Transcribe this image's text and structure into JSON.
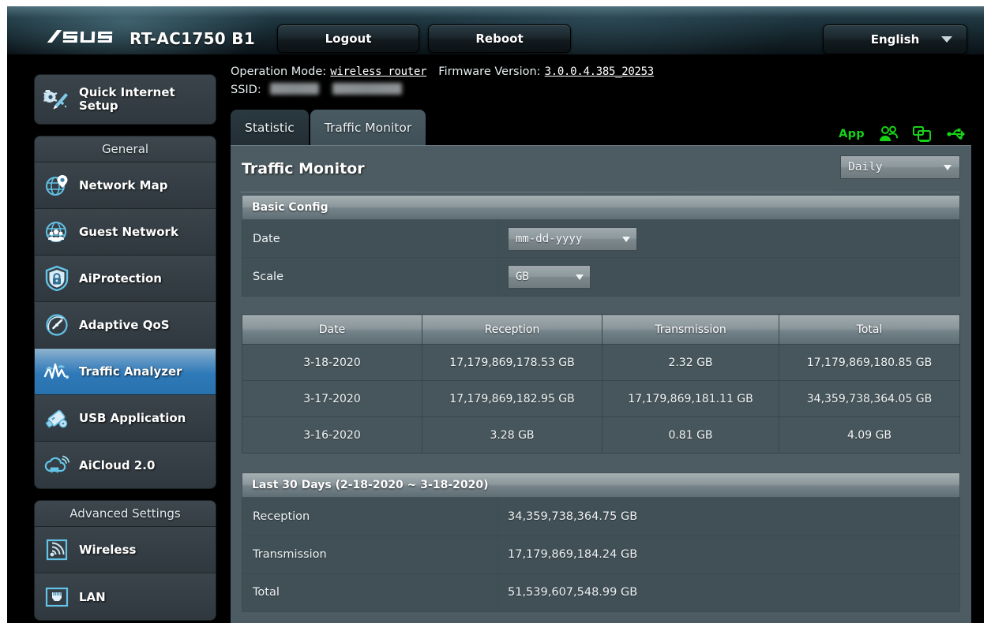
{
  "header": {
    "brand": "/ISUS",
    "model": "RT-AC1750 B1",
    "logout_label": "Logout",
    "reboot_label": "Reboot",
    "language": "English",
    "language_caret": "chevron-down-icon"
  },
  "info": {
    "operation_mode_label": "Operation Mode:",
    "operation_mode_value": "wireless router",
    "firmware_label": "Firmware Version:",
    "firmware_value": "3.0.0.4.385_20253",
    "ssid_label": "SSID:",
    "ssid_value_1": "",
    "ssid_value_2": ""
  },
  "top_icons": {
    "app_label": "App",
    "icons": [
      "clients-icon",
      "screen-share-icon",
      "usb-icon"
    ],
    "color": "#17d217"
  },
  "sidebar": {
    "quick": {
      "label_line1": "Quick Internet",
      "label_line2": "Setup",
      "icon": "quick-setup-icon"
    },
    "groups": [
      {
        "title": "General",
        "items": [
          {
            "label": "Network Map",
            "icon": "network-map-icon",
            "active": false
          },
          {
            "label": "Guest Network",
            "icon": "guest-network-icon",
            "active": false
          },
          {
            "label": "AiProtection",
            "icon": "shield-lock-icon",
            "active": false
          },
          {
            "label": "Adaptive QoS",
            "icon": "gauge-icon",
            "active": false
          },
          {
            "label": "Traffic Analyzer",
            "icon": "traffic-analyzer-icon",
            "active": true
          },
          {
            "label": "USB Application",
            "icon": "usb-drive-icon",
            "active": false
          },
          {
            "label": "AiCloud 2.0",
            "icon": "cloud-icon",
            "active": false
          }
        ]
      },
      {
        "title": "Advanced Settings",
        "items": [
          {
            "label": "Wireless",
            "icon": "wireless-icon",
            "active": false
          },
          {
            "label": "LAN",
            "icon": "lan-port-icon",
            "active": false
          }
        ]
      }
    ]
  },
  "tabs": [
    {
      "label": "Statistic",
      "active": false
    },
    {
      "label": "Traffic Monitor",
      "active": true
    }
  ],
  "panel": {
    "title": "Traffic Monitor",
    "period_selected": "Daily",
    "basic_config": {
      "section_title": "Basic Config",
      "rows": [
        {
          "label": "Date",
          "value": "mm-dd-yyyy"
        },
        {
          "label": "Scale",
          "value": "GB"
        }
      ]
    },
    "table": {
      "columns": [
        "Date",
        "Reception",
        "Transmission",
        "Total"
      ],
      "rows": [
        [
          "3-18-2020",
          "17,179,869,178.53 GB",
          "2.32 GB",
          "17,179,869,180.85 GB"
        ],
        [
          "3-17-2020",
          "17,179,869,182.95 GB",
          "17,179,869,181.11 GB",
          "34,359,738,364.05 GB"
        ],
        [
          "3-16-2020",
          "3.28 GB",
          "0.81 GB",
          "4.09 GB"
        ]
      ]
    },
    "summary": {
      "section_title": "Last 30 Days (2-18-2020 ~ 3-18-2020)",
      "rows": [
        {
          "label": "Reception",
          "value": "34,359,738,364.75 GB"
        },
        {
          "label": "Transmission",
          "value": "17,179,869,184.24 GB"
        },
        {
          "label": "Total",
          "value": "51,539,607,548.99 GB"
        }
      ]
    }
  },
  "colors": {
    "accent_blue": "#2e79b8",
    "panel_bg": "#4d5c62",
    "row_bg": "#414f56",
    "green": "#17d217",
    "icon_blue": "#5ec7ef"
  }
}
